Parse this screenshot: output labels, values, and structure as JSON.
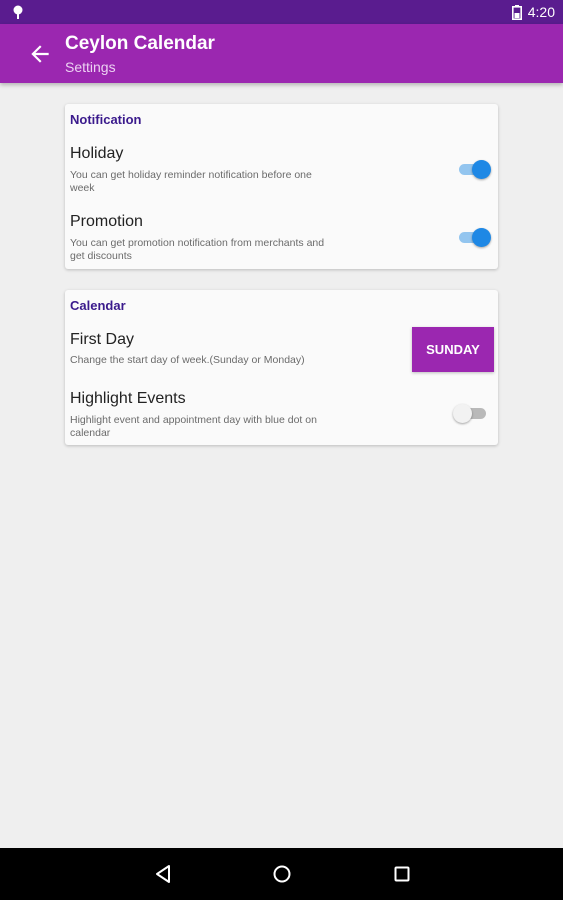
{
  "status_bar": {
    "time": "4:20"
  },
  "app_bar": {
    "title": "Ceylon Calendar",
    "subtitle": "Settings",
    "back_icon": "arrow-back-icon"
  },
  "notification_section": {
    "header": "Notification",
    "items": [
      {
        "title": "Holiday",
        "description": "You can get holiday reminder notification before one week",
        "enabled": true
      },
      {
        "title": "Promotion",
        "description": "You can get promotion notification from merchants and get discounts",
        "enabled": true
      }
    ]
  },
  "calendar_section": {
    "header": "Calendar",
    "first_day": {
      "title": "First Day",
      "description": "Change the start day of week.(Sunday or Monday)",
      "button_label": "SUNDAY"
    },
    "highlight_events": {
      "title": "Highlight Events",
      "description": "Highlight event and appointment day with blue dot on calendar",
      "enabled": false
    }
  },
  "colors": {
    "status_bar": "#5a1c8f",
    "app_bar": "#9b27b0",
    "section_header": "#3a1a8c",
    "switch_on": "#1e88e5",
    "background": "#efefef"
  },
  "nav_bar": {
    "icons": [
      "back-triangle-icon",
      "home-circle-icon",
      "recents-square-icon"
    ]
  }
}
